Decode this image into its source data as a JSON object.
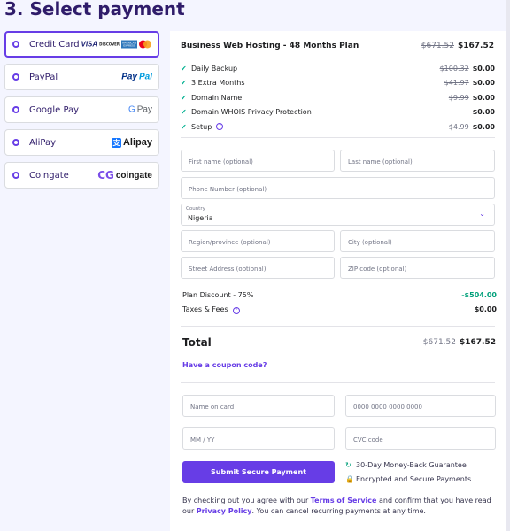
{
  "page": {
    "title": "3. Select payment"
  },
  "methods": [
    {
      "label": "Credit Card",
      "active": true
    },
    {
      "label": "PayPal"
    },
    {
      "label": "Google Pay"
    },
    {
      "label": "AliPay"
    },
    {
      "label": "Coingate"
    }
  ],
  "logos": {
    "visa": "VISA",
    "discover": "DISCOVER",
    "amex": "AMERICAN EXPRESS",
    "paypal_1": "Pay",
    "paypal_2": "Pal",
    "gpay_g": "G",
    "gpay_pay": " Pay",
    "alipay_icon": "支",
    "alipay": "Alipay",
    "coingate_icon": "CG",
    "coingate": "coingate"
  },
  "order": {
    "plan": "Business Web Hosting - 48 Months Plan",
    "plan_old": "$671.52",
    "plan_price": "$167.52",
    "items": [
      {
        "label": "Daily Backup",
        "old": "$100.32",
        "price": "$0.00"
      },
      {
        "label": "3 Extra Months",
        "old": "$41.97",
        "price": "$0.00"
      },
      {
        "label": "Domain Name",
        "old": "$9.99",
        "price": "$0.00"
      },
      {
        "label": "Domain WHOIS Privacy Protection",
        "old": "",
        "price": "$0.00"
      },
      {
        "label": "Setup",
        "old": "$4.99",
        "price": "$0.00"
      }
    ]
  },
  "billing": {
    "first_name": "First name (optional)",
    "last_name": "Last name (optional)",
    "phone": "Phone Number (optional)",
    "country_label": "Country",
    "country_value": "Nigeria",
    "region": "Region/province (optional)",
    "city": "City (optional)",
    "street": "Street Address (optional)",
    "zip": "ZIP code (optional)"
  },
  "summary": {
    "discount_label": "Plan Discount - 75%",
    "discount_value": "-$504.00",
    "taxes_label": "Taxes & Fees",
    "taxes_value": "$0.00",
    "total_label": "Total",
    "total_old": "$671.52",
    "total_value": "$167.52",
    "coupon": "Have a coupon code?"
  },
  "card": {
    "name": "Name on card",
    "number": "0000 0000 0000 0000",
    "expiry": "MM / YY",
    "cvc": "CVC code"
  },
  "submit": "Submit Secure Payment",
  "guarantees": [
    "30-Day Money-Back Guarantee",
    "Encrypted and Secure Payments"
  ],
  "terms": {
    "t1": "By checking out you agree with our ",
    "tos": "Terms of Service",
    "t2": " and confirm that you have read our ",
    "privacy": "Privacy Policy",
    "t3": ". You can cancel recurring payments at any time."
  },
  "colors": {
    "accent": "#673de6",
    "success": "#00a07a",
    "text": "#2f1c6a"
  }
}
